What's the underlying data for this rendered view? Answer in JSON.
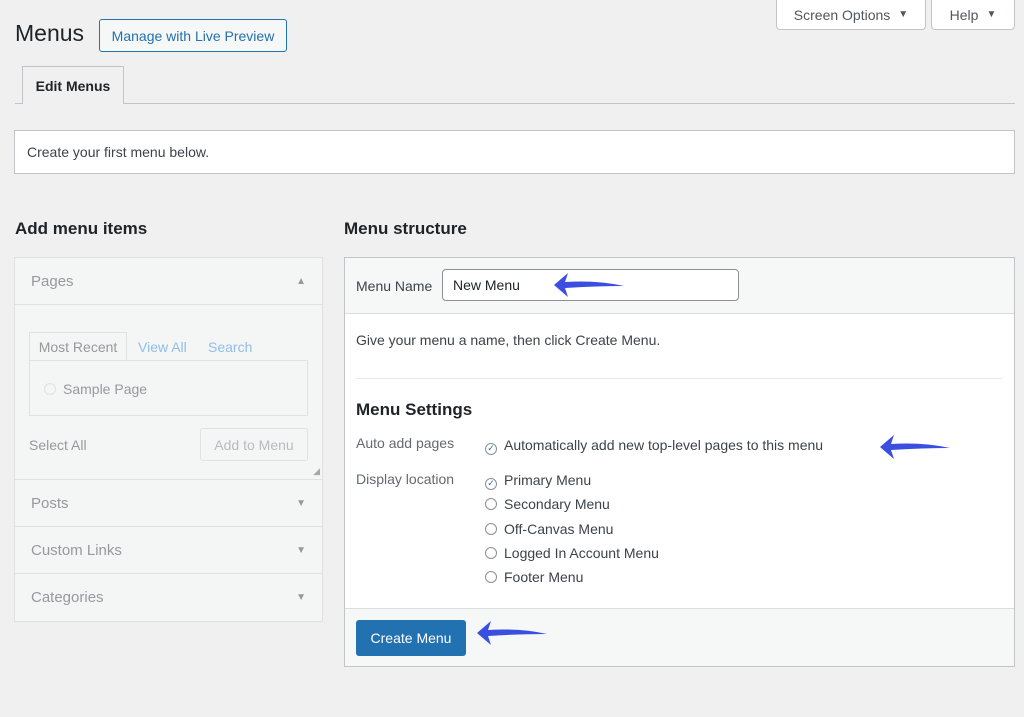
{
  "header": {
    "title": "Menus",
    "live_preview": "Manage with Live Preview",
    "screen_options": "Screen Options",
    "help": "Help"
  },
  "tabs": [
    {
      "label": "Edit Menus",
      "active": true
    }
  ],
  "notice": "Create your first menu below.",
  "left": {
    "heading": "Add menu items",
    "sections": [
      {
        "label": "Pages",
        "expanded": true
      },
      {
        "label": "Posts"
      },
      {
        "label": "Custom Links"
      },
      {
        "label": "Categories"
      }
    ],
    "pages_tabs": [
      "Most Recent",
      "View All",
      "Search"
    ],
    "page_items": [
      {
        "label": "Sample Page",
        "checked": false
      }
    ],
    "select_all": "Select All",
    "add_to_menu": "Add to Menu"
  },
  "right": {
    "heading": "Menu structure",
    "menu_name_label": "Menu Name",
    "menu_name_value": "New Menu",
    "instructions": "Give your menu a name, then click Create Menu.",
    "settings_heading": "Menu Settings",
    "auto_add_label": "Auto add pages",
    "auto_add_option": {
      "label": "Automatically add new top-level pages to this menu",
      "checked": true
    },
    "display_location_label": "Display location",
    "locations": [
      {
        "label": "Primary Menu",
        "checked": true
      },
      {
        "label": "Secondary Menu",
        "checked": false
      },
      {
        "label": "Off-Canvas Menu",
        "checked": false
      },
      {
        "label": "Logged In Account Menu",
        "checked": false
      },
      {
        "label": "Footer Menu",
        "checked": false
      }
    ],
    "create_button": "Create Menu"
  },
  "colors": {
    "accent": "#2271b1",
    "annotation_arrow": "#3a4fe0"
  }
}
